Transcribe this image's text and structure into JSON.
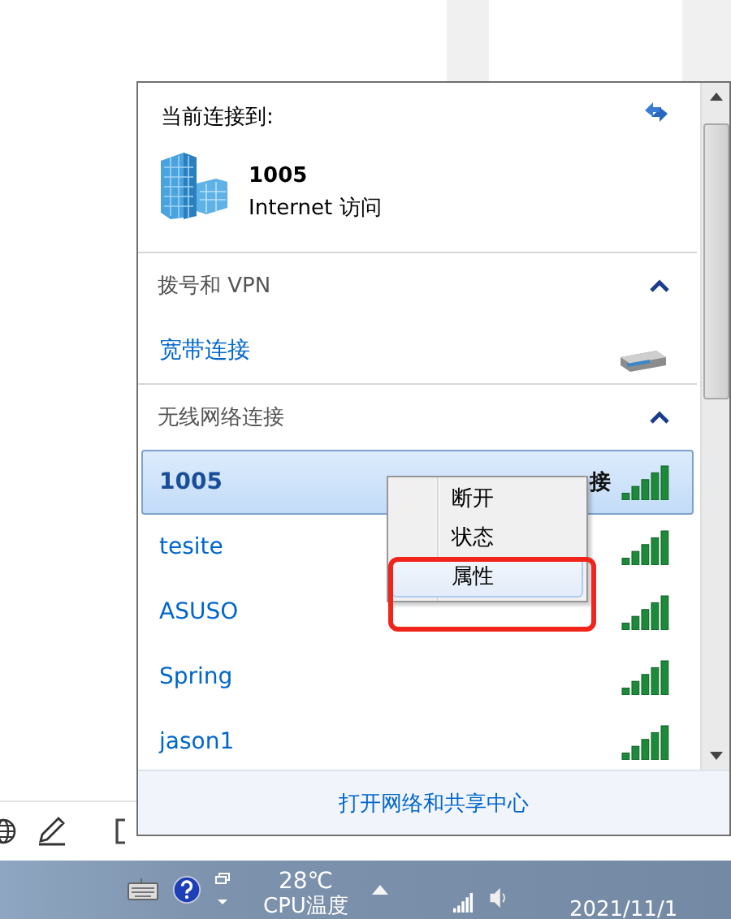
{
  "flyout": {
    "current_label": "当前连接到:",
    "current_network": {
      "name": "1005",
      "access": "Internet 访问"
    },
    "sections": [
      {
        "title": "拨号和 VPN",
        "expanded": true,
        "items": [
          {
            "kind": "dialup",
            "name": "宽带连接",
            "selected": false
          }
        ]
      },
      {
        "title": "无线网络连接",
        "expanded": true,
        "items": [
          {
            "kind": "wifi",
            "name": "1005",
            "status": "接",
            "selected": true
          },
          {
            "kind": "wifi",
            "name": "tesite",
            "selected": false
          },
          {
            "kind": "wifi",
            "name": "ASUSO",
            "selected": false
          },
          {
            "kind": "wifi",
            "name": "Spring",
            "selected": false
          },
          {
            "kind": "wifi",
            "name": "jason1",
            "selected": false
          }
        ]
      }
    ],
    "footer_link": "打开网络和共享中心"
  },
  "context_menu": {
    "items": [
      {
        "label": "断开",
        "selected": false,
        "circled": false
      },
      {
        "label": "状态",
        "selected": false,
        "circled": false
      },
      {
        "label": "属性",
        "selected": true,
        "circled": true
      }
    ]
  },
  "taskbar": {
    "temperature": "28℃",
    "temperature_label": "CPU温度",
    "date": "2021/11/1"
  }
}
